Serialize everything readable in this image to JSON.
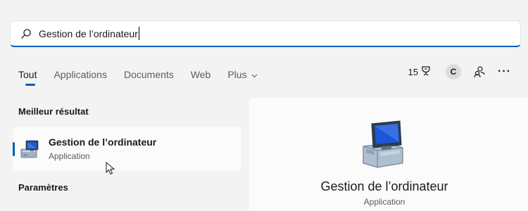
{
  "search": {
    "value": "Gestion de l’ordinateur"
  },
  "tabs": [
    {
      "label": "Tout"
    },
    {
      "label": "Applications"
    },
    {
      "label": "Documents"
    },
    {
      "label": "Web"
    },
    {
      "label": "Plus"
    }
  ],
  "toolbar": {
    "points": "15",
    "avatar_initial": "C"
  },
  "best_match": {
    "heading": "Meilleur résultat",
    "title": "Gestion de l’ordinateur",
    "subtitle": "Application"
  },
  "settings_section": {
    "heading": "Paramètres"
  },
  "detail": {
    "title": "Gestion de l’ordinateur",
    "subtitle": "Application"
  },
  "colors": {
    "accent": "#005fb8",
    "background": "#f3f3f3",
    "card": "#fbfbfb"
  },
  "icons": [
    "search-icon",
    "rewards-trophy-icon",
    "people-icon",
    "more-options-icon",
    "computer-management-icon",
    "mouse-cursor-icon"
  ]
}
